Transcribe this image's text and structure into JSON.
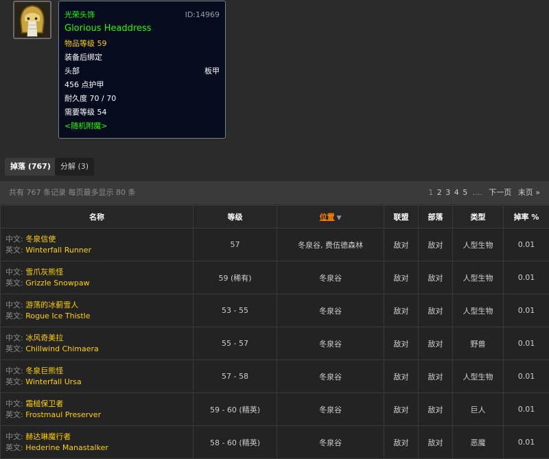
{
  "item": {
    "icon": "helmet-icon",
    "name_cn": "光荣头饰",
    "id_text": "ID:14969",
    "name_en": "Glorious Headdress",
    "item_level": "物品等级 59",
    "bind": "装备后绑定",
    "slot": "头部",
    "armor_type": "板甲",
    "armor": "456 点护甲",
    "durability": "耐久度 70 / 70",
    "required_level": "需要等级 54",
    "enchant": "<随机附魔>"
  },
  "tabs": [
    {
      "label": "掉落 (767)",
      "active": true
    },
    {
      "label": "分解 (3)",
      "active": false
    }
  ],
  "summary": "共有 767 条记录 每页最多显示 80 条",
  "pagination": {
    "pages": [
      "1",
      "2",
      "3",
      "4",
      "5"
    ],
    "current": "1",
    "ellipsis": "....",
    "next": "下一页",
    "last": "末页 »"
  },
  "table": {
    "headers": {
      "name": "名称",
      "level": "等级",
      "location": "位置",
      "alliance": "联盟",
      "horde": "部落",
      "type": "类型",
      "drop_rate": "掉率 %"
    },
    "cn_label": "中文:",
    "en_label": "英文:",
    "rows": [
      {
        "cn": "冬泉信使",
        "en": "Winterfall Runner",
        "level": "57",
        "location": "冬泉谷, 费伍德森林",
        "alliance": "敌对",
        "horde": "敌对",
        "type": "人型生物",
        "rate": "0.01"
      },
      {
        "cn": "雪爪灰熊怪",
        "en": "Grizzle Snowpaw",
        "level": "59 (稀有)",
        "location": "冬泉谷",
        "alliance": "敌对",
        "horde": "敌对",
        "type": "人型生物",
        "rate": "0.01"
      },
      {
        "cn": "游荡的冰蓟雪人",
        "en": "Rogue Ice Thistle",
        "level": "53 - 55",
        "location": "冬泉谷",
        "alliance": "敌对",
        "horde": "敌对",
        "type": "人型生物",
        "rate": "0.01"
      },
      {
        "cn": "冰风奇美拉",
        "en": "Chillwind Chimaera",
        "level": "55 - 57",
        "location": "冬泉谷",
        "alliance": "敌对",
        "horde": "敌对",
        "type": "野兽",
        "rate": "0.01"
      },
      {
        "cn": "冬泉巨熊怪",
        "en": "Winterfall Ursa",
        "level": "57 - 58",
        "location": "冬泉谷",
        "alliance": "敌对",
        "horde": "敌对",
        "type": "人型生物",
        "rate": "0.01"
      },
      {
        "cn": "霜槌保卫者",
        "en": "Frostmaul Preserver",
        "level": "59 - 60 (精英)",
        "location": "冬泉谷",
        "alliance": "敌对",
        "horde": "敌对",
        "type": "巨人",
        "rate": "0.01"
      },
      {
        "cn": "赫达琳魔行者",
        "en": "Hederine Manastalker",
        "level": "58 - 60 (精英)",
        "location": "冬泉谷",
        "alliance": "敌对",
        "horde": "敌对",
        "type": "恶魔",
        "rate": "0.01"
      }
    ]
  },
  "colors": {
    "background": "#2b2b2b",
    "uncommon_green": "#1eff00",
    "name_gold": "#ffd100",
    "hostile_red": "#e0322c",
    "sort_orange": "#ff8000",
    "tooltip_bg": "#070b1e"
  }
}
